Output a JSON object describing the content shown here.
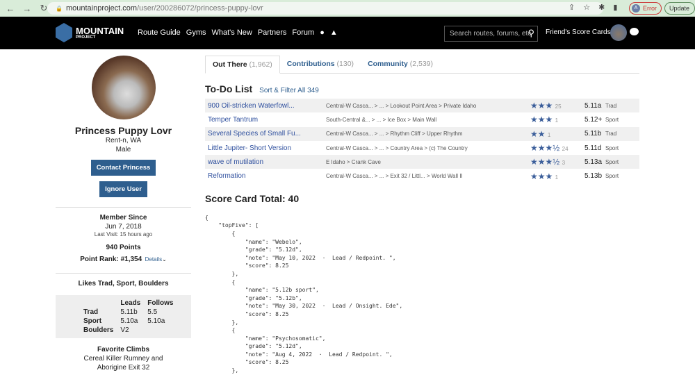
{
  "browser": {
    "url_host": "mountainproject.com",
    "url_path": "/user/200286072/princess-puppy-lovr",
    "profile_initial": "A",
    "error_label": "Error",
    "update_label": "Update"
  },
  "nav": {
    "logo_main": "MOUNTAIN",
    "logo_sub": "PROJECT",
    "items": [
      "Route Guide",
      "Gyms",
      "What's New",
      "Partners",
      "Forum"
    ],
    "search_placeholder": "Search routes, forums, etc",
    "friends": "Friend's Score Cards"
  },
  "profile": {
    "name": "Princess Puppy Lovr",
    "location": "Rent-n, WA",
    "gender": "Male",
    "contact": "Contact Princess",
    "ignore": "Ignore User",
    "member_since_label": "Member Since",
    "member_since": "Jun 7, 2018",
    "last_visit": "Last Visit: 15 hours ago",
    "points": "940 Points",
    "rank": "Point Rank: #1,354",
    "details": "Details",
    "likes": "Likes Trad, Sport, Boulders",
    "grades": {
      "headers": [
        "",
        "Leads",
        "Follows"
      ],
      "rows": [
        [
          "Trad",
          "5.11b",
          "5.5"
        ],
        [
          "Sport",
          "5.10a",
          "5.10a"
        ],
        [
          "Boulders",
          "V2",
          ""
        ]
      ]
    },
    "fav_label": "Favorite Climbs",
    "fav_1": "Cereal Killer Rumney and",
    "fav_2": "Aborigine Exit 32"
  },
  "tabs": [
    {
      "label": "Out There",
      "count": "(1,962)"
    },
    {
      "label": "Contributions",
      "count": "(130)"
    },
    {
      "label": "Community",
      "count": "(2,539)"
    }
  ],
  "todo": {
    "title": "To-Do List",
    "sort": "Sort & Filter All 349",
    "rows": [
      {
        "name": "900 Oil-stricken Waterfowl...",
        "loc": "Central-W Casca... > ... > Lookout Point Area > Private Idaho",
        "stars": "★★★",
        "votes": "25",
        "grade": "5.11a",
        "type": "Trad"
      },
      {
        "name": "Temper Tantrum",
        "loc": "South-Central &... > ... > Ice Box > Main Wall",
        "stars": "★★★",
        "votes": "1",
        "grade": "5.12+",
        "type": "Sport"
      },
      {
        "name": "Several Species of Small Fu...",
        "loc": "Central-W Casca... > ... > Rhythm Cliff > Upper Rhythm",
        "stars": "★★",
        "votes": "1",
        "grade": "5.11b",
        "type": "Trad"
      },
      {
        "name": "Little Jupiter- Short Version",
        "loc": "Central-W Casca... > ... > Country Area > (c) The Country",
        "stars": "★★★½",
        "votes": "24",
        "grade": "5.11d",
        "type": "Sport"
      },
      {
        "name": "wave of mutilation",
        "loc": "E Idaho > Crank Cave",
        "stars": "★★★½",
        "votes": "3",
        "grade": "5.13a",
        "type": "Sport"
      },
      {
        "name": "Reformation",
        "loc": "Central-W Casca... > ... > Exit 32 / Littl... > World Wall II",
        "stars": "★★★",
        "votes": "1",
        "grade": "5.13b",
        "type": "Sport"
      }
    ]
  },
  "scorecard": {
    "title": "Score Card Total: 40",
    "code": "{\n    \"topFive\": [\n        {\n            \"name\": \"Webelo\",\n            \"grade\": \"5.12d\",\n            \"note\": \"May 10, 2022  ·  Lead / Redpoint. \",\n            \"score\": 8.25\n        },\n        {\n            \"name\": \"5.12b sport\",\n            \"grade\": \"5.12b\",\n            \"note\": \"May 30, 2022  ·  Lead / Onsight. Ede\",\n            \"score\": 8.25\n        },\n        {\n            \"name\": \"Psychosomatic\",\n            \"grade\": \"5.12d\",\n            \"note\": \"Aug 4, 2022  ·  Lead / Redpoint. \",\n            \"score\": 8.25\n        },"
  }
}
